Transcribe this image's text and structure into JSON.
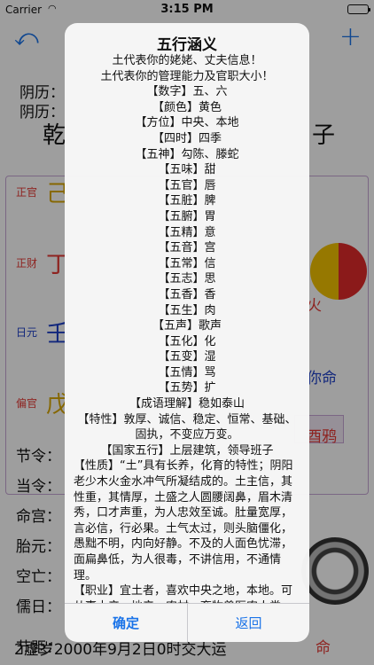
{
  "status_bar": {
    "carrier": "Carrier",
    "time": "3:15 PM"
  },
  "background": {
    "rows": {
      "r1": "阴历：",
      "r2": "阴历：",
      "qian": "乾",
      "zi": "子",
      "l1": "正官",
      "l2": "正财",
      "l3": "日元",
      "l4": "偏官",
      "c1": "己",
      "c2": "丁",
      "c3": "壬",
      "c4": "戊",
      "fire": "火",
      "ming": "你命",
      "ya": "酉鸦",
      "jieling": "节令：",
      "dangling": "当令：",
      "minggong": "命宫：",
      "taiyuan": "胎元：",
      "kongwang": "空亡：",
      "ruyuan": "儒日：",
      "jieju": "节距：",
      "bottom": "2虚岁2000年9月2日0时交大运",
      "ming2": "命"
    }
  },
  "alert": {
    "title": "五行涵义",
    "lines": [
      "土代表你的姥姥、丈夫信息！",
      "土代表你的管理能力及官职大小！",
      "【数字】五、六",
      "【颜色】黄色",
      "【方位】中央、本地",
      "【四时】四季",
      "【五神】勾陈、滕蛇",
      "【五味】甜",
      "【五官】唇",
      "【五脏】脾",
      "【五腑】胃",
      "【五精】意",
      "【五音】宫",
      "【五常】信",
      "【五志】思",
      "【五香】香",
      "【五生】肉",
      "【五声】歌声",
      "【五化】化",
      "【五变】湿",
      "【五情】骂",
      "【五势】扩",
      "【成语理解】稳如泰山",
      "【特性】敦厚、诚信、稳定、恒常、基础、固执，不变应万变。",
      "【国家五行】上层建筑，领导班子"
    ],
    "para1": "【性质】“土”具有长养，化育的特性；阴阳老少木火金水冲气所凝结成的。土主信，其性重，其情厚，土盛之人圆腰阔鼻，眉木清秀，口才声重，为人忠效至诚。肚量宽厚，言必信，行必果。土气太过，则头脑僵化，愚黜不明，内向好静。不及的人面色忧滞，面扁鼻低，为人很毒，不讲信用，不通情理。",
    "para2": "【职业】宜土者，喜欢中央之地，本地。可从事土产、地产、农村、畜牧兽医农人类、布匹、服装、纺织、石料、石灰、山地水泥、建筑、房地产买卖、当水的雨具、雨伞、雨帽、筑堤、容水物",
    "ok_label": "确定",
    "back_label": "返回"
  }
}
